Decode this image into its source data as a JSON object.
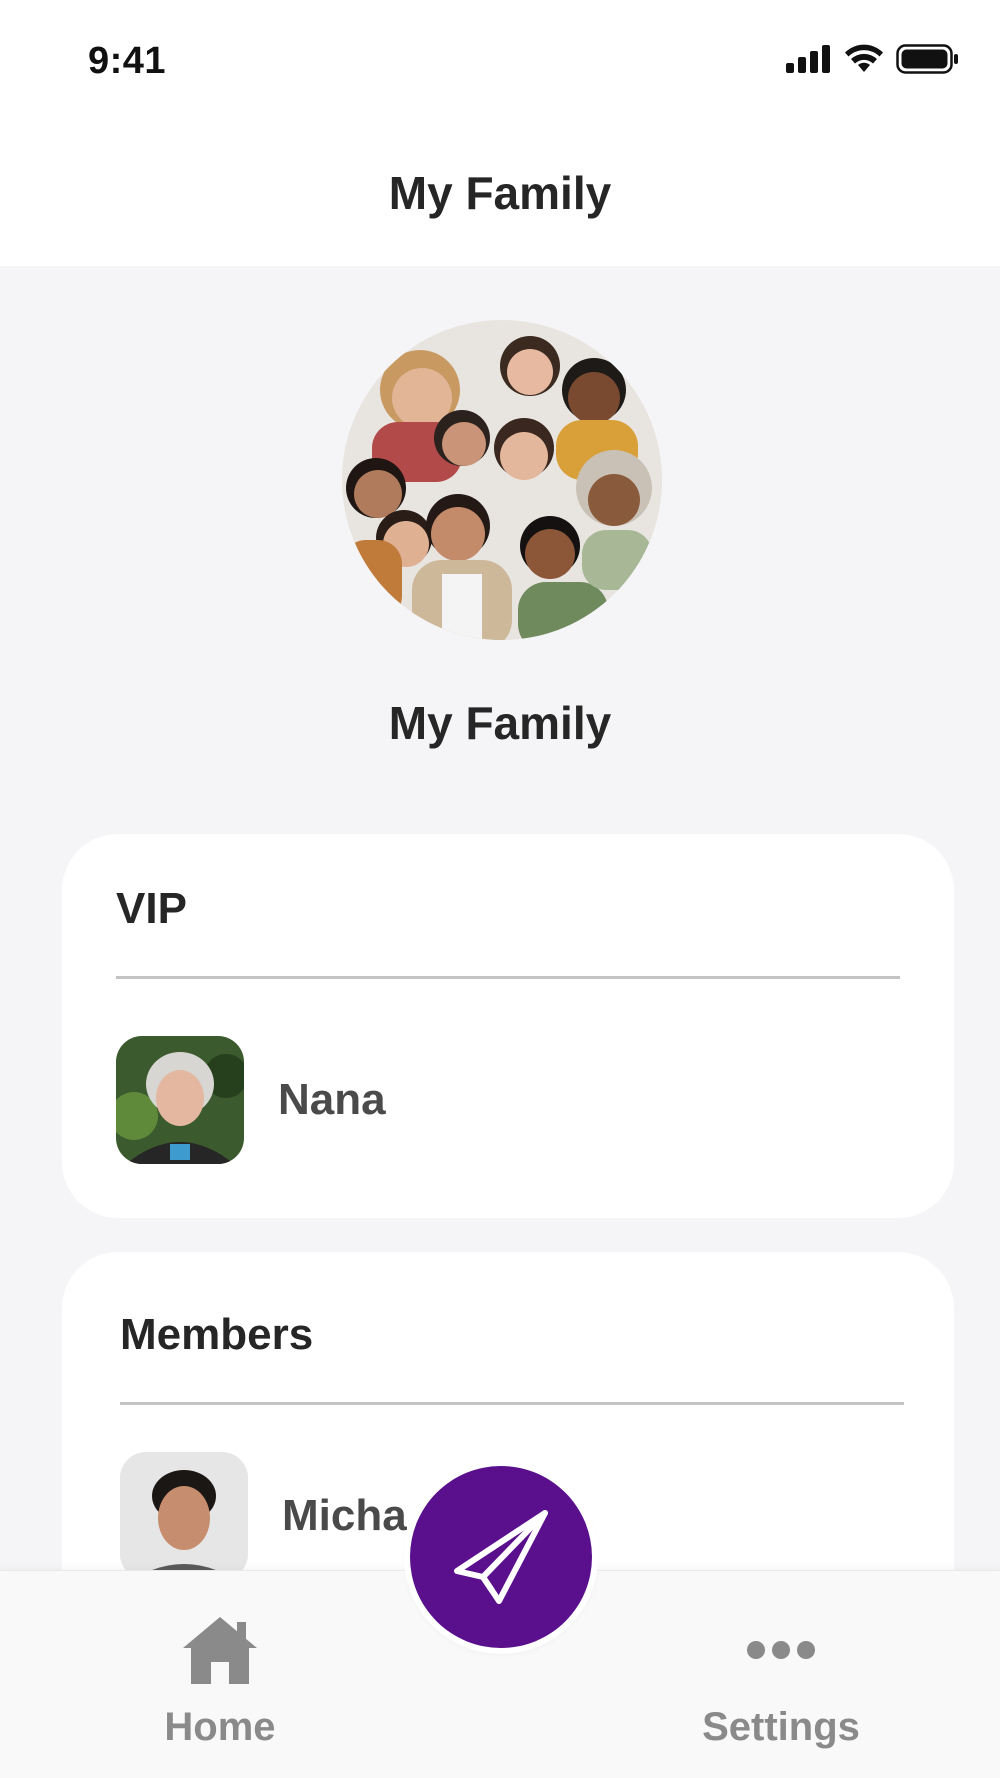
{
  "status_bar": {
    "time": "9:41",
    "icons": [
      "signal-icon",
      "wifi-icon",
      "battery-icon"
    ]
  },
  "header": {
    "title": "My Family"
  },
  "group": {
    "name": "My Family",
    "photo_icon": "group-photo"
  },
  "vip_section": {
    "title": "VIP",
    "members": [
      {
        "name": "Nana"
      }
    ]
  },
  "members_section": {
    "title": "Members",
    "members": [
      {
        "name": "Micha"
      }
    ]
  },
  "fab": {
    "icon": "paper-plane-icon",
    "color": "#5a0f8c"
  },
  "tab_bar": {
    "home_label": "Home",
    "settings_label": "Settings",
    "home_icon": "home-icon",
    "settings_icon": "more-dots-icon"
  }
}
